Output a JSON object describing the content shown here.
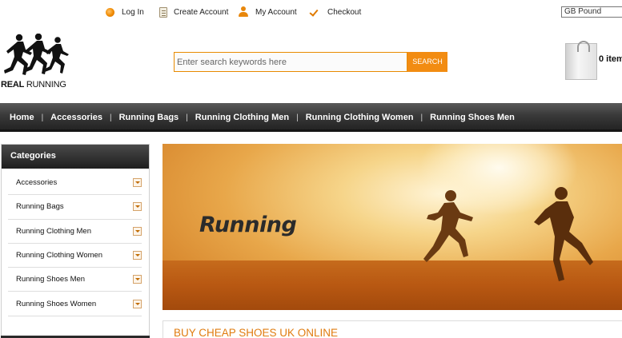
{
  "topbar": {
    "links": [
      {
        "label": "Log In",
        "icon": "login-icon"
      },
      {
        "label": "Create Account",
        "icon": "create-account-icon"
      },
      {
        "label": "My Account",
        "icon": "user-icon"
      },
      {
        "label": "Checkout",
        "icon": "checkmark-icon"
      }
    ],
    "currency": "GB Pound"
  },
  "header": {
    "logo_bold": "REAL",
    "logo_thin": "RUNNING",
    "search_placeholder": "Enter search keywords here",
    "search_button": "SEARCH",
    "cart_count": "0 item"
  },
  "nav": {
    "items": [
      "Home",
      "Accessories",
      "Running Bags",
      "Running Clothing Men",
      "Running Clothing Women",
      "Running Shoes Men"
    ]
  },
  "sidebar": {
    "title": "Categories",
    "categories": [
      "Accessories",
      "Running Bags",
      "Running Clothing Men",
      "Running Clothing Women",
      "Running Shoes Men",
      "Running Shoes Women"
    ]
  },
  "banner": {
    "title": "Running"
  },
  "promo": {
    "title": "BUY CHEAP SHOES UK ONLINE"
  },
  "colors": {
    "accent": "#f28c12",
    "nav_bg": "#2e2e2e",
    "promo_text": "#e07c10"
  }
}
